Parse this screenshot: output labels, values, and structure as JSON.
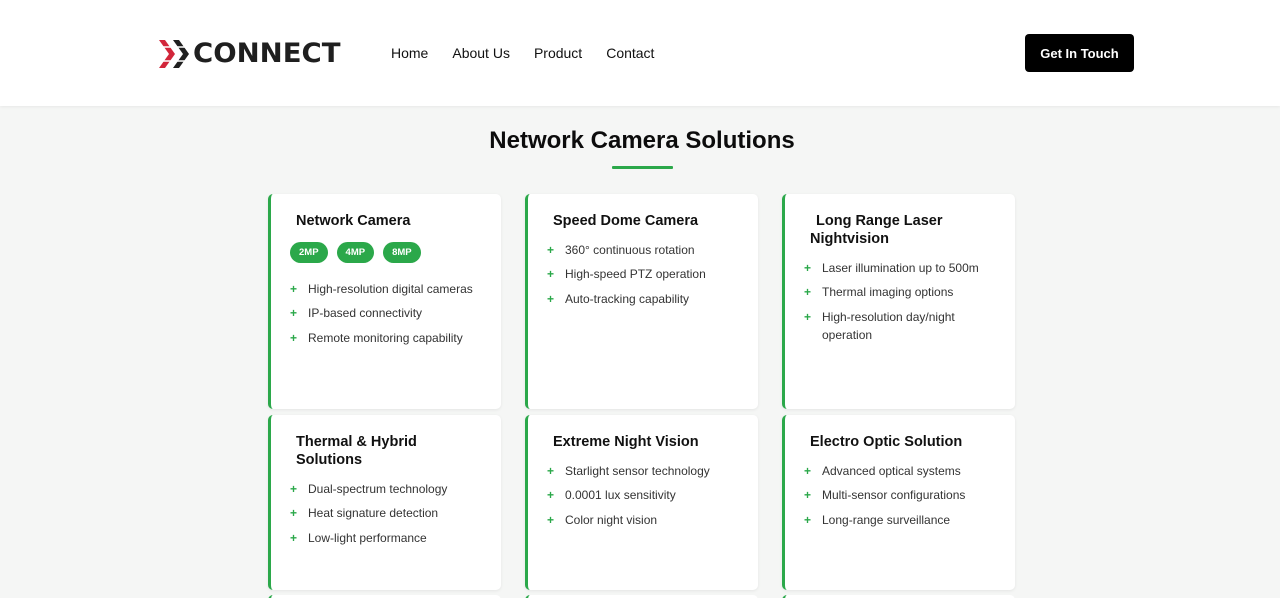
{
  "brand": {
    "logo_text": "CONNECT",
    "accent": "#2ba84a",
    "logo_red": "#d2263a"
  },
  "nav": {
    "items": [
      "Home",
      "About Us",
      "Product",
      "Contact"
    ],
    "cta": "Get In Touch"
  },
  "section": {
    "title": "Network Camera Solutions"
  },
  "cards": [
    {
      "title": "Network Camera",
      "badges": [
        "2MP",
        "4MP",
        "8MP"
      ],
      "features": [
        "High-resolution digital cameras",
        "IP-based connectivity",
        "Remote monitoring capability"
      ]
    },
    {
      "title": "Speed Dome Camera",
      "features": [
        "360° continuous rotation",
        "High-speed PTZ operation",
        "Auto-tracking capability"
      ]
    },
    {
      "title": "Long Range Laser Nightvision",
      "features": [
        "Laser illumination up to 500m",
        "Thermal imaging options",
        "High-resolution day/night operation"
      ]
    },
    {
      "title": "Thermal & Hybrid Solutions",
      "features": [
        "Dual-spectrum technology",
        "Heat signature detection",
        "Low-light performance"
      ]
    },
    {
      "title": "Extreme Night Vision",
      "features": [
        "Starlight sensor technology",
        "0.0001 lux sensitivity",
        "Color night vision"
      ]
    },
    {
      "title": "Electro Optic Solution",
      "features": [
        "Advanced optical systems",
        "Multi-sensor configurations",
        "Long-range surveillance"
      ]
    }
  ]
}
